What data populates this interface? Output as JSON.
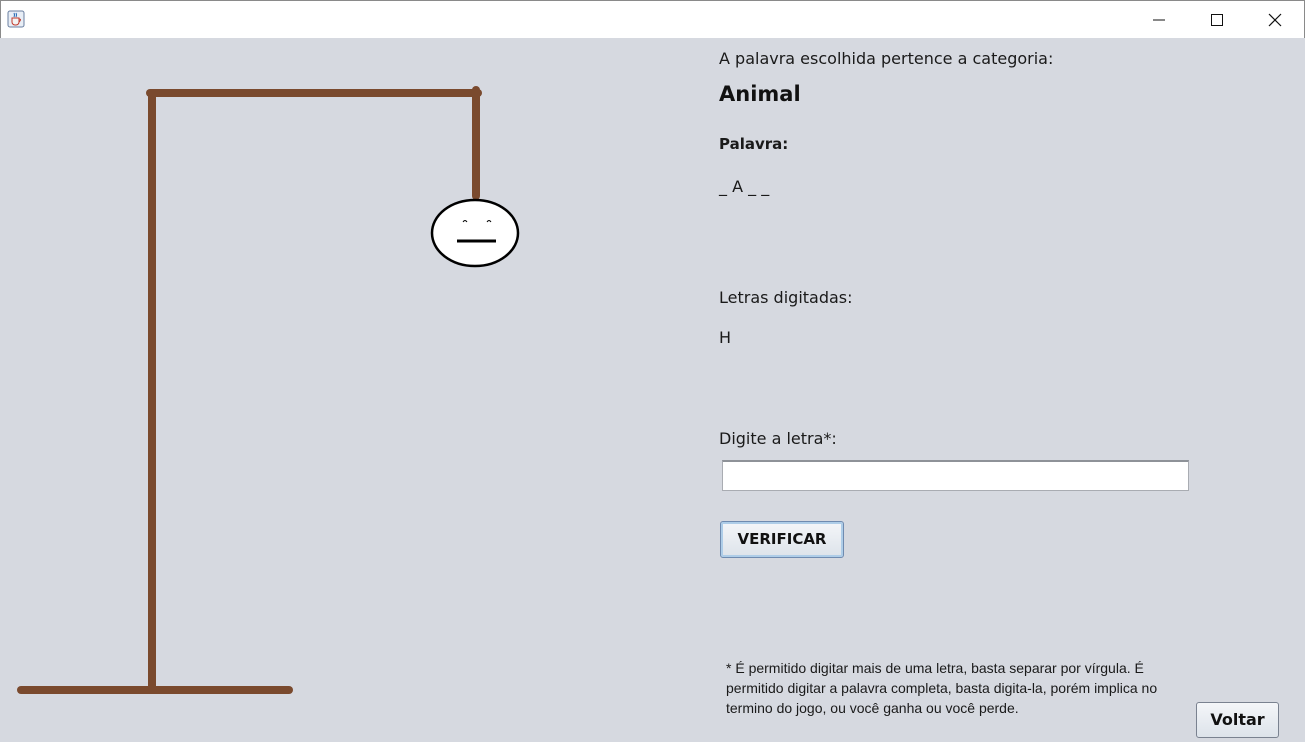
{
  "window": {
    "icon": "java-cup-icon",
    "controls": [
      "minimize-icon",
      "maximize-icon",
      "close-icon"
    ]
  },
  "game": {
    "category_label": "A palavra escolhida pertence a categoria:",
    "category_value": "Animal",
    "word_label": "Palavra:",
    "word_value": "_ A _ _",
    "typed_label": "Letras digitadas:",
    "typed_value": "H",
    "input_label": "Digite a letra*:",
    "input_value": "",
    "verify_button": "VERIFICAR",
    "note": "* É permitido digitar mais de uma letra, basta separar por vírgula. É permitido digitar a palavra completa, basta digita-la, porém implica no termino do jogo, ou você ganha ou você perde.",
    "back_button": "Voltar"
  },
  "colors": {
    "background": "#d6d9e0",
    "gallows": "#7a4a2e",
    "face_outline": "#000000"
  }
}
